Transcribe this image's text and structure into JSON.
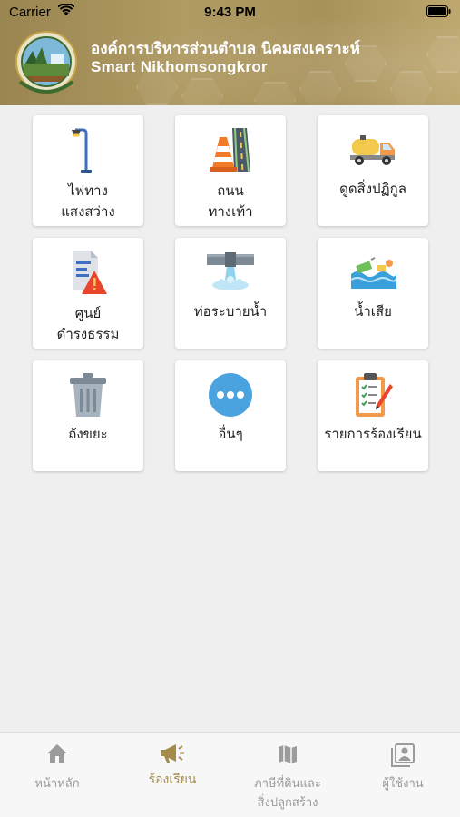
{
  "status": {
    "carrier": "Carrier",
    "time": "9:43 PM"
  },
  "header": {
    "title": "องค์การบริหารส่วนตำบล นิคมสงเคราะห์",
    "subtitle": "Smart Nikhomsongkror",
    "brand_color": "#a8925b"
  },
  "menu": [
    {
      "line1": "ไฟทาง",
      "line2": "แสงสว่าง",
      "icon": "streetlight-icon"
    },
    {
      "line1": "ถนน",
      "line2": "ทางเท้า",
      "icon": "road-icon"
    },
    {
      "line1": "ดูดสิ่งปฏิกูล",
      "line2": "",
      "icon": "septic-truck-icon"
    },
    {
      "line1": "ศูนย์",
      "line2": "ดำรงธรรม",
      "icon": "document-warning-icon"
    },
    {
      "line1": "ท่อระบายน้ำ",
      "line2": "",
      "icon": "drain-pipe-icon"
    },
    {
      "line1": "น้ำเสีย",
      "line2": "",
      "icon": "wastewater-icon"
    },
    {
      "line1": "ถังขยะ",
      "line2": "",
      "icon": "trash-bin-icon"
    },
    {
      "line1": "อื่นๆ",
      "line2": "",
      "icon": "more-icon"
    },
    {
      "line1": "รายการร้องเรียน",
      "line2": "",
      "icon": "clipboard-checklist-icon"
    }
  ],
  "tabs": [
    {
      "line1": "หน้าหลัก",
      "line2": "",
      "icon": "home-icon",
      "active": false
    },
    {
      "line1": "ร้องเรียน",
      "line2": "",
      "icon": "megaphone-icon",
      "active": true
    },
    {
      "line1": "ภาษีที่ดินและ",
      "line2": "สิ่งปลูกสร้าง",
      "icon": "map-icon",
      "active": false
    },
    {
      "line1": "ผู้ใช้งาน",
      "line2": "",
      "icon": "user-profile-icon",
      "active": false
    }
  ],
  "colors": {
    "active_tab": "#a38a4d",
    "inactive_tab": "#9b9b9b",
    "background": "#efefef"
  }
}
